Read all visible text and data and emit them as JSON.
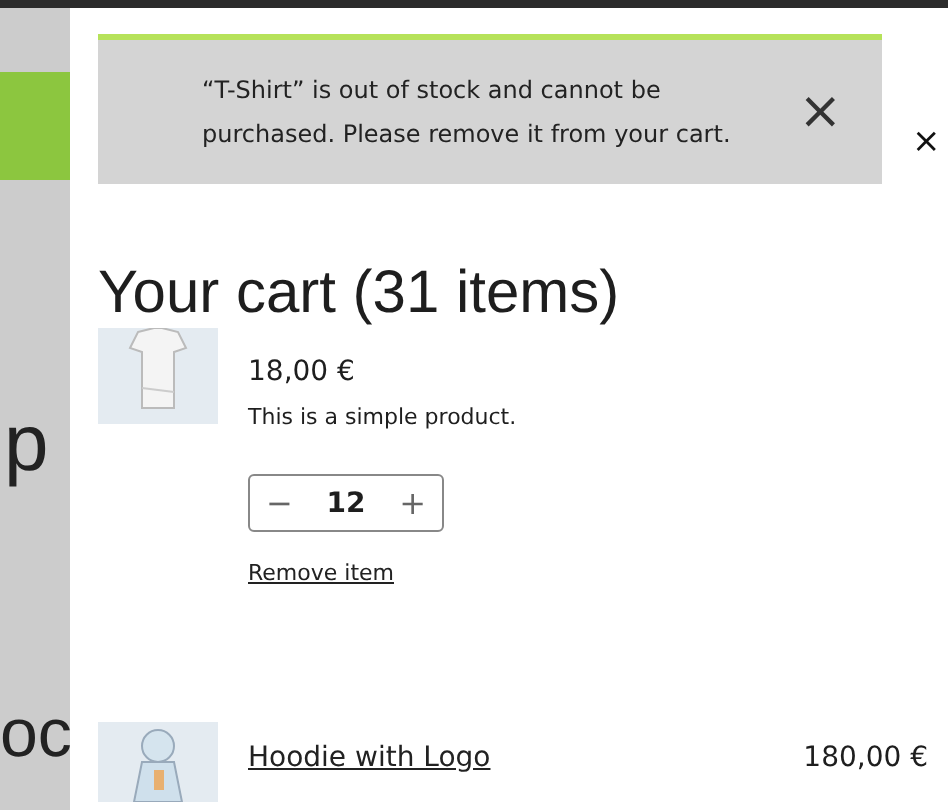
{
  "background_text": [
    "p",
    "oc"
  ],
  "notice": {
    "message": "“T-Shirt” is out of stock and cannot be purchased. Please remove it from your cart.",
    "dismiss": "×"
  },
  "close": "×",
  "heading": "Your cart (31 items)",
  "items": [
    {
      "kind": "shirt",
      "unit_price": "18,00 €",
      "description": "This is a simple product.",
      "quantity": "12",
      "minus": "−",
      "plus": "+",
      "remove": "Remove item"
    },
    {
      "kind": "hoodie",
      "name": "Hoodie with Logo",
      "total": "180,00 €"
    }
  ]
}
